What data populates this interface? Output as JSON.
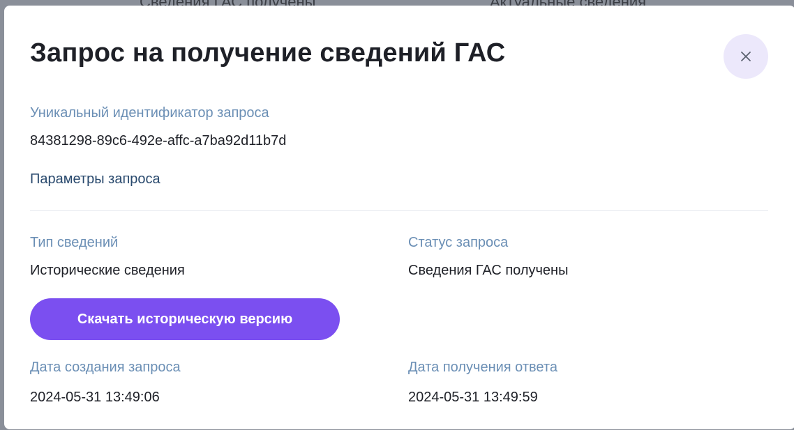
{
  "background": {
    "left_text": "Сведения ГАС получены",
    "right_text": "Актуальные сведения"
  },
  "modal": {
    "title": "Запрос на получение сведений ГАС",
    "close_icon": "close-icon",
    "request_id_label": "Уникальный идентификатор запроса",
    "request_id_value": "84381298-89c6-492e-affc-a7ba92d11b7d",
    "params_heading": "Параметры запроса",
    "info_type_label": "Тип сведений",
    "info_type_value": "Исторические сведения",
    "status_label": "Статус запроса",
    "status_value": "Сведения ГАС получены",
    "download_button": "Скачать историческую версию",
    "created_label": "Дата создания запроса",
    "created_value": "2024-05-31 13:49:06",
    "response_label": "Дата получения ответа",
    "response_value": "2024-05-31 13:49:59"
  },
  "colors": {
    "accent": "#7b4ff0",
    "label": "#6b8fb5",
    "close_bg": "#ece8fb"
  }
}
